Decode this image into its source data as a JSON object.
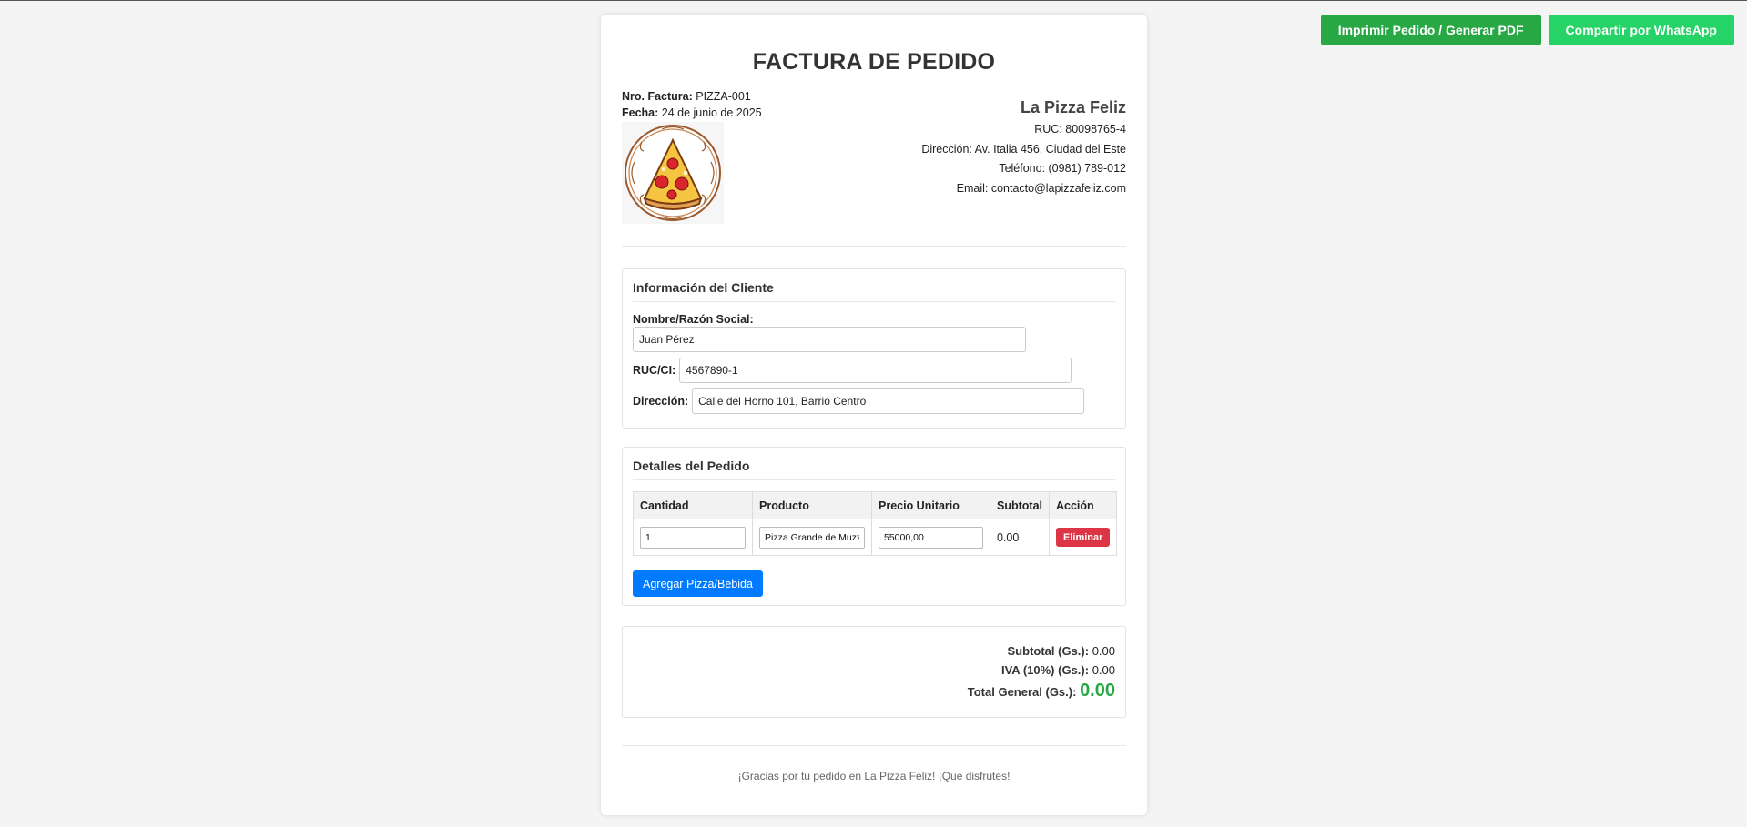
{
  "actions": {
    "print_label": "Imprimir Pedido / Generar PDF",
    "whatsapp_label": "Compartir por WhatsApp"
  },
  "invoice": {
    "title": "FACTURA DE PEDIDO",
    "number_label": "Nro. Factura:",
    "number_value": "PIZZA-001",
    "date_label": "Fecha:",
    "date_value": "24 de junio de 2025"
  },
  "company": {
    "name": "La Pizza Feliz",
    "ruc": "RUC: 80098765-4",
    "address": "Dirección: Av. Italia 456, Ciudad del Este",
    "phone": "Teléfono: (0981) 789-012",
    "email": "Email: contacto@lapizzafeliz.com",
    "logo_icon": "pizza-slice-icon"
  },
  "client": {
    "section_title": "Información del Cliente",
    "name_label": "Nombre/Razón Social:",
    "name_value": "Juan Pérez",
    "ruc_label": "RUC/CI:",
    "ruc_value": "4567890-1",
    "address_label": "Dirección:",
    "address_value": "Calle del Horno 101, Barrio Centro"
  },
  "order": {
    "section_title": "Detalles del Pedido",
    "columns": [
      "Cantidad",
      "Producto",
      "Precio Unitario",
      "Subtotal",
      "Acción"
    ],
    "rows": [
      {
        "qty": "1",
        "product": "Pizza Grande de Muzzarella",
        "unit_price": "55000,00",
        "subtotal": "0.00",
        "action_label": "Eliminar"
      }
    ],
    "add_label": "Agregar Pizza/Bebida"
  },
  "totals": {
    "subtotal_label": "Subtotal (Gs.):",
    "subtotal_value": "0.00",
    "iva_label": "IVA (10%) (Gs.):",
    "iva_value": "0.00",
    "total_label": "Total General (Gs.):",
    "total_value": "0.00"
  },
  "footer": {
    "message": "¡Gracias por tu pedido en La Pizza Feliz! ¡Que disfrutes!"
  },
  "colors": {
    "print_button": "#28a745",
    "whatsapp_button": "#25d366",
    "delete_button": "#dc3545",
    "add_button": "#007bff",
    "total_value": "#28a745"
  }
}
